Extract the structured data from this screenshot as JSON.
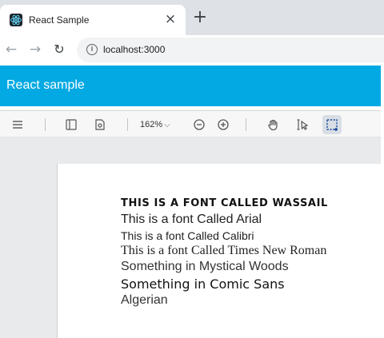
{
  "browser": {
    "tab": {
      "title": "React Sample",
      "close_glyph": "×",
      "favicon": "react-icon"
    },
    "new_tab_glyph": "+",
    "nav": {
      "back": "←",
      "forward": "→",
      "reload": "↻"
    },
    "address": {
      "info_glyph": "i",
      "url": "localhost:3000"
    }
  },
  "app": {
    "title": "React sample",
    "header_color": "#03a9e2"
  },
  "pdf_toolbar": {
    "zoom_label": "162%",
    "zoom_chevron": "⌵",
    "tools": [
      "menu-icon",
      "sidebar-toggle-icon",
      "page-properties-icon",
      "zoom-out-icon",
      "zoom-in-icon",
      "pan-tool-icon",
      "text-select-icon",
      "marquee-select-icon"
    ]
  },
  "document": {
    "lines": [
      "THIS IS A FONT CALLED WASSAIL",
      "This is a font Called Arial",
      "This is a font Called Calibri",
      "This is a font Called Times New Roman",
      "Something in Mystical Woods",
      "Something in Comic Sans",
      "Algerian"
    ]
  }
}
